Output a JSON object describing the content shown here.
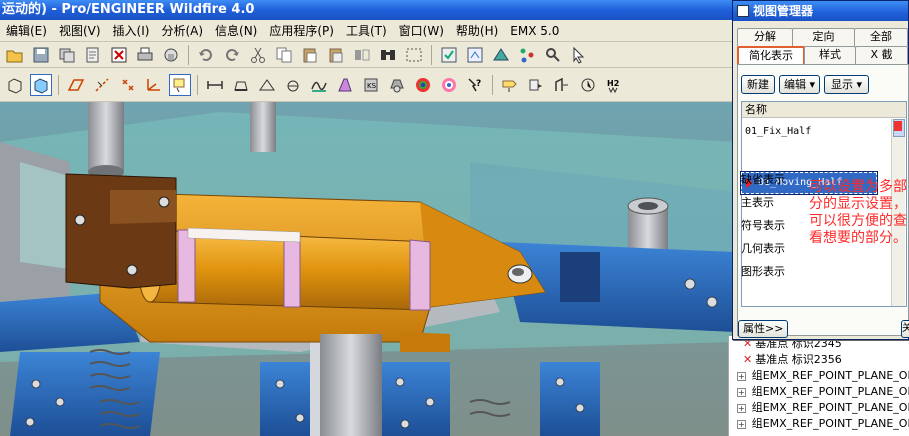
{
  "window": {
    "title": "运动的) - Pro/ENGINEER Wildfire 4.0"
  },
  "menu": [
    "编辑(E)",
    "视图(V)",
    "插入(I)",
    "分析(A)",
    "信息(N)",
    "应用程序(P)",
    "工具(T)",
    "窗口(W)",
    "帮助(H)",
    "EMX 5.0"
  ],
  "dialog": {
    "title": "视图管理器",
    "tabs_row1": [
      "分解",
      "定向",
      "全部"
    ],
    "tabs_row2": [
      "简化表示",
      "样式",
      "X 截"
    ],
    "active_tab": "简化表示",
    "buttons": {
      "new": "新建",
      "edit": "编辑 ▾",
      "display": "显示 ▾"
    },
    "list_header": "名称",
    "items": [
      "01_Fix_Half",
      "01_Moving_Half"
    ],
    "selected_item": "01_Moving_Half",
    "categories": [
      "缺省表示",
      "主表示",
      "符号表示",
      "几何表示",
      "图形表示"
    ],
    "annotation": "可以设置为多部分的显示设置，可以很方便的查看想要的部分。",
    "properties_button": "属性>>",
    "close_button": "关"
  },
  "model_tree": {
    "rows": [
      {
        "type": "datum-point",
        "label": "基准点 标识2345"
      },
      {
        "type": "datum-point",
        "label": "基准点 标识2356"
      },
      {
        "type": "group",
        "label": "组EMX_REF_POINT_PLANE_OF"
      },
      {
        "type": "group",
        "label": "组EMX_REF_POINT_PLANE_OF"
      },
      {
        "type": "group",
        "label": "组EMX_REF_POINT_PLANE_OF"
      },
      {
        "type": "group",
        "label": "组EMX_REF_POINT_PLANE_OF"
      }
    ]
  },
  "colors": {
    "titlebar": "#1f5fd9",
    "annotation": "#ff2a2a",
    "selection": "#316ac5",
    "active_tab_border": "#e06030",
    "moving_plate": "#e89a10",
    "fixed_plate": "#2f6fc2"
  },
  "icons_toolbar1": [
    "open-icon",
    "save-icon",
    "copy-window-icon",
    "rename-icon",
    "close-window-icon",
    "print-icon",
    "email-icon",
    "undo-icon",
    "redo-icon",
    "cut-icon",
    "copy-icon",
    "paste-icon",
    "paste-special-icon",
    "mirror-icon",
    "find-icon",
    "select-box-icon",
    "regenerate-icon",
    "view-manager-icon",
    "layers-icon",
    "model-tree-icon",
    "search-tool-icon",
    "pointer-icon"
  ],
  "icons_toolbar2": [
    "shaded-icon",
    "no-hidden-icon",
    "datum-plane-icon",
    "datum-axis-icon",
    "datum-point-icon",
    "coordinate-system-icon",
    "annotation-icon",
    "measure-icon",
    "section-icon",
    "surface-icon",
    "sketch-icon",
    "analysis-icon",
    "appearance-icon",
    "color-wheel-icon",
    "whats-this-icon",
    "mold-icon",
    "ejector-icon",
    "slider-icon",
    "cooling-icon",
    "emx-icon"
  ]
}
